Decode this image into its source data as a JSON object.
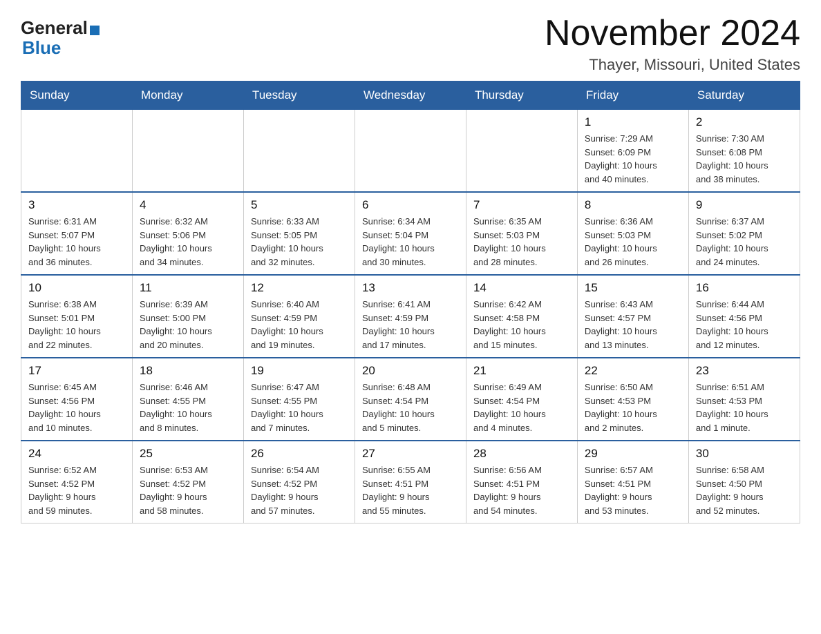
{
  "logo": {
    "line1": "General",
    "triangle": "▶",
    "line2": "Blue"
  },
  "title": "November 2024",
  "subtitle": "Thayer, Missouri, United States",
  "weekdays": [
    "Sunday",
    "Monday",
    "Tuesday",
    "Wednesday",
    "Thursday",
    "Friday",
    "Saturday"
  ],
  "weeks": [
    [
      {
        "day": "",
        "info": ""
      },
      {
        "day": "",
        "info": ""
      },
      {
        "day": "",
        "info": ""
      },
      {
        "day": "",
        "info": ""
      },
      {
        "day": "",
        "info": ""
      },
      {
        "day": "1",
        "info": "Sunrise: 7:29 AM\nSunset: 6:09 PM\nDaylight: 10 hours\nand 40 minutes."
      },
      {
        "day": "2",
        "info": "Sunrise: 7:30 AM\nSunset: 6:08 PM\nDaylight: 10 hours\nand 38 minutes."
      }
    ],
    [
      {
        "day": "3",
        "info": "Sunrise: 6:31 AM\nSunset: 5:07 PM\nDaylight: 10 hours\nand 36 minutes."
      },
      {
        "day": "4",
        "info": "Sunrise: 6:32 AM\nSunset: 5:06 PM\nDaylight: 10 hours\nand 34 minutes."
      },
      {
        "day": "5",
        "info": "Sunrise: 6:33 AM\nSunset: 5:05 PM\nDaylight: 10 hours\nand 32 minutes."
      },
      {
        "day": "6",
        "info": "Sunrise: 6:34 AM\nSunset: 5:04 PM\nDaylight: 10 hours\nand 30 minutes."
      },
      {
        "day": "7",
        "info": "Sunrise: 6:35 AM\nSunset: 5:03 PM\nDaylight: 10 hours\nand 28 minutes."
      },
      {
        "day": "8",
        "info": "Sunrise: 6:36 AM\nSunset: 5:03 PM\nDaylight: 10 hours\nand 26 minutes."
      },
      {
        "day": "9",
        "info": "Sunrise: 6:37 AM\nSunset: 5:02 PM\nDaylight: 10 hours\nand 24 minutes."
      }
    ],
    [
      {
        "day": "10",
        "info": "Sunrise: 6:38 AM\nSunset: 5:01 PM\nDaylight: 10 hours\nand 22 minutes."
      },
      {
        "day": "11",
        "info": "Sunrise: 6:39 AM\nSunset: 5:00 PM\nDaylight: 10 hours\nand 20 minutes."
      },
      {
        "day": "12",
        "info": "Sunrise: 6:40 AM\nSunset: 4:59 PM\nDaylight: 10 hours\nand 19 minutes."
      },
      {
        "day": "13",
        "info": "Sunrise: 6:41 AM\nSunset: 4:59 PM\nDaylight: 10 hours\nand 17 minutes."
      },
      {
        "day": "14",
        "info": "Sunrise: 6:42 AM\nSunset: 4:58 PM\nDaylight: 10 hours\nand 15 minutes."
      },
      {
        "day": "15",
        "info": "Sunrise: 6:43 AM\nSunset: 4:57 PM\nDaylight: 10 hours\nand 13 minutes."
      },
      {
        "day": "16",
        "info": "Sunrise: 6:44 AM\nSunset: 4:56 PM\nDaylight: 10 hours\nand 12 minutes."
      }
    ],
    [
      {
        "day": "17",
        "info": "Sunrise: 6:45 AM\nSunset: 4:56 PM\nDaylight: 10 hours\nand 10 minutes."
      },
      {
        "day": "18",
        "info": "Sunrise: 6:46 AM\nSunset: 4:55 PM\nDaylight: 10 hours\nand 8 minutes."
      },
      {
        "day": "19",
        "info": "Sunrise: 6:47 AM\nSunset: 4:55 PM\nDaylight: 10 hours\nand 7 minutes."
      },
      {
        "day": "20",
        "info": "Sunrise: 6:48 AM\nSunset: 4:54 PM\nDaylight: 10 hours\nand 5 minutes."
      },
      {
        "day": "21",
        "info": "Sunrise: 6:49 AM\nSunset: 4:54 PM\nDaylight: 10 hours\nand 4 minutes."
      },
      {
        "day": "22",
        "info": "Sunrise: 6:50 AM\nSunset: 4:53 PM\nDaylight: 10 hours\nand 2 minutes."
      },
      {
        "day": "23",
        "info": "Sunrise: 6:51 AM\nSunset: 4:53 PM\nDaylight: 10 hours\nand 1 minute."
      }
    ],
    [
      {
        "day": "24",
        "info": "Sunrise: 6:52 AM\nSunset: 4:52 PM\nDaylight: 9 hours\nand 59 minutes."
      },
      {
        "day": "25",
        "info": "Sunrise: 6:53 AM\nSunset: 4:52 PM\nDaylight: 9 hours\nand 58 minutes."
      },
      {
        "day": "26",
        "info": "Sunrise: 6:54 AM\nSunset: 4:52 PM\nDaylight: 9 hours\nand 57 minutes."
      },
      {
        "day": "27",
        "info": "Sunrise: 6:55 AM\nSunset: 4:51 PM\nDaylight: 9 hours\nand 55 minutes."
      },
      {
        "day": "28",
        "info": "Sunrise: 6:56 AM\nSunset: 4:51 PM\nDaylight: 9 hours\nand 54 minutes."
      },
      {
        "day": "29",
        "info": "Sunrise: 6:57 AM\nSunset: 4:51 PM\nDaylight: 9 hours\nand 53 minutes."
      },
      {
        "day": "30",
        "info": "Sunrise: 6:58 AM\nSunset: 4:50 PM\nDaylight: 9 hours\nand 52 minutes."
      }
    ]
  ]
}
